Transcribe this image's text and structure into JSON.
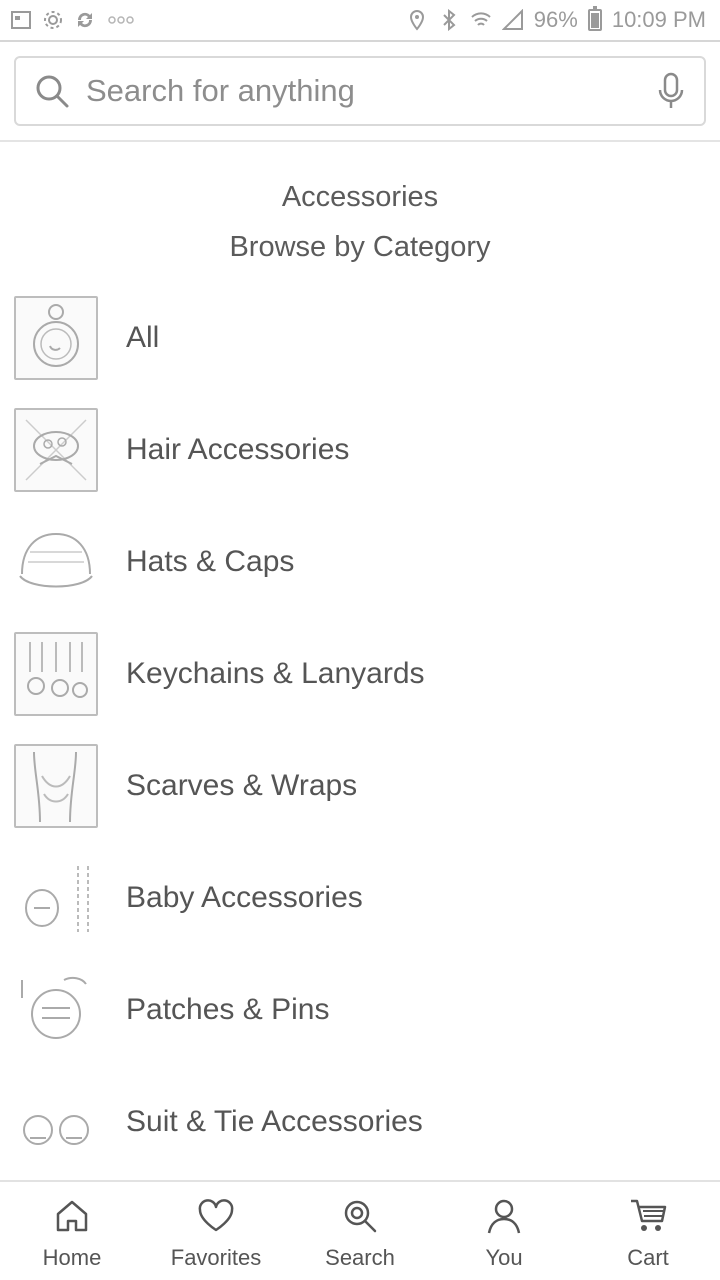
{
  "status_bar": {
    "battery_percent": "96%",
    "time": "10:09 PM",
    "left_icons": [
      "image-icon",
      "gear-icon",
      "sync-icon",
      "more-dots-icon"
    ],
    "right_icons": [
      "location-icon",
      "bluetooth-icon",
      "wifi-icon",
      "signal-icon",
      "battery-icon"
    ]
  },
  "search": {
    "placeholder": "Search for anything",
    "value": ""
  },
  "header": {
    "title": "Accessories",
    "subtitle": "Browse by Category"
  },
  "categories": [
    {
      "label": "All",
      "icon": "pocket-watch-thumbnail"
    },
    {
      "label": "Hair Accessories",
      "icon": "hair-accessory-thumbnail"
    },
    {
      "label": "Hats & Caps",
      "icon": "cap-thumbnail"
    },
    {
      "label": "Keychains & Lanyards",
      "icon": "keychain-thumbnail"
    },
    {
      "label": "Scarves & Wraps",
      "icon": "scarf-thumbnail"
    },
    {
      "label": "Baby Accessories",
      "icon": "baby-accessory-thumbnail"
    },
    {
      "label": "Patches & Pins",
      "icon": "patch-thumbnail"
    },
    {
      "label": "Suit & Tie Accessories",
      "icon": "cufflinks-thumbnail"
    }
  ],
  "bottom_nav": {
    "items": [
      {
        "label": "Home",
        "icon": "home-icon"
      },
      {
        "label": "Favorites",
        "icon": "heart-icon"
      },
      {
        "label": "Search",
        "icon": "search-icon"
      },
      {
        "label": "You",
        "icon": "user-icon"
      },
      {
        "label": "Cart",
        "icon": "cart-icon"
      }
    ]
  },
  "colors": {
    "text": "#555555",
    "icon": "#9a9a9a",
    "divider": "#e2e2e2"
  }
}
